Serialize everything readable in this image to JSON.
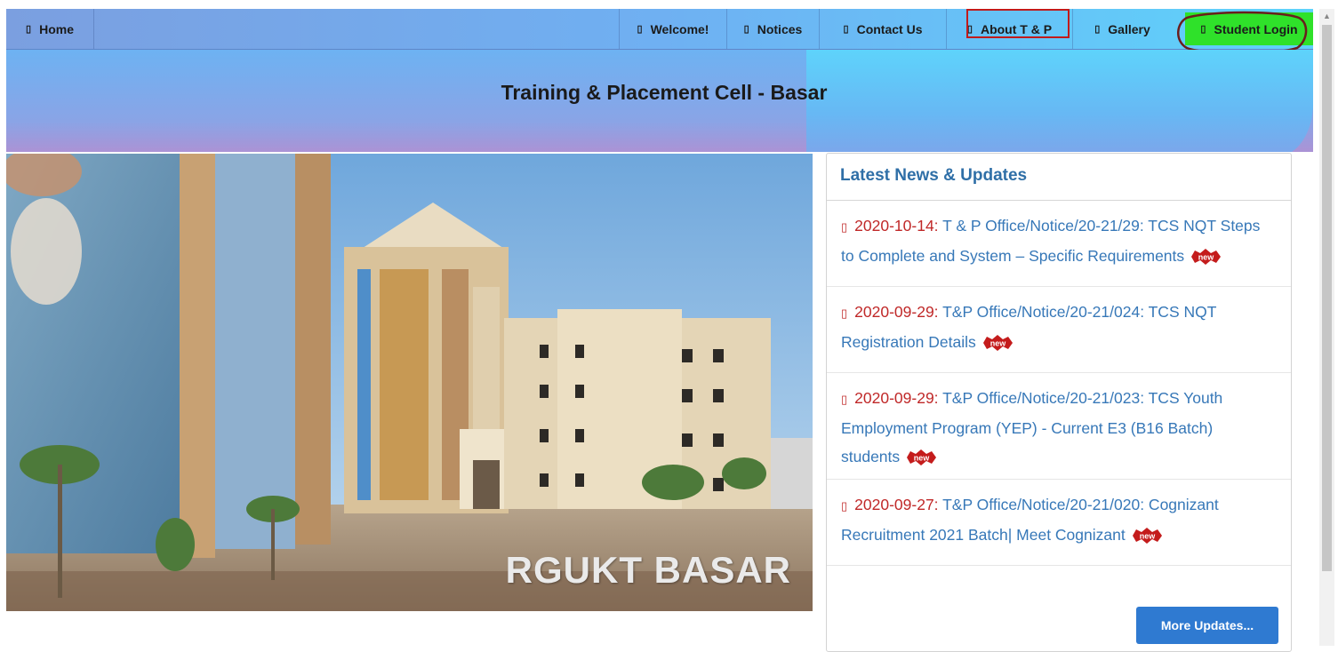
{
  "nav": {
    "home": "Home",
    "welcome": "Welcome!",
    "notices": "Notices",
    "contact": "Contact Us",
    "about": "About T & P",
    "gallery": "Gallery",
    "login": "Student Login",
    "glyph": "▯"
  },
  "header": {
    "title": "Training & Placement Cell - Basar"
  },
  "photo": {
    "caption": "RGUKT BASAR"
  },
  "news": {
    "heading": "Latest News & Updates",
    "badge": "new",
    "items": [
      {
        "date": "2020-10-14:",
        "title": "T & P Office/Notice/20-21/29: TCS NQT Steps to Complete and System – Specific Requirements"
      },
      {
        "date": "2020-09-29:",
        "title": "T&P Office/Notice/20-21/024: TCS NQT Registration Details"
      },
      {
        "date": "2020-09-29:",
        "title": "T&P Office/Notice/20-21/023: TCS Youth Employment Program (YEP) - Current E3 (B16 Batch) students"
      },
      {
        "date": "2020-09-27:",
        "title": "T&P Office/Notice/20-21/020: Cognizant Recruitment 2021 Batch| Meet Cognizant"
      }
    ],
    "more_label": "More Updates..."
  },
  "colors": {
    "nav_gradient_start": "#7b9fe0",
    "nav_gradient_end": "#5ed3fb",
    "login_green": "#2fe12a",
    "news_heading": "#2f6fa7",
    "news_date": "#c02828",
    "news_link": "#3778b8",
    "button_blue": "#2f7ad1"
  }
}
